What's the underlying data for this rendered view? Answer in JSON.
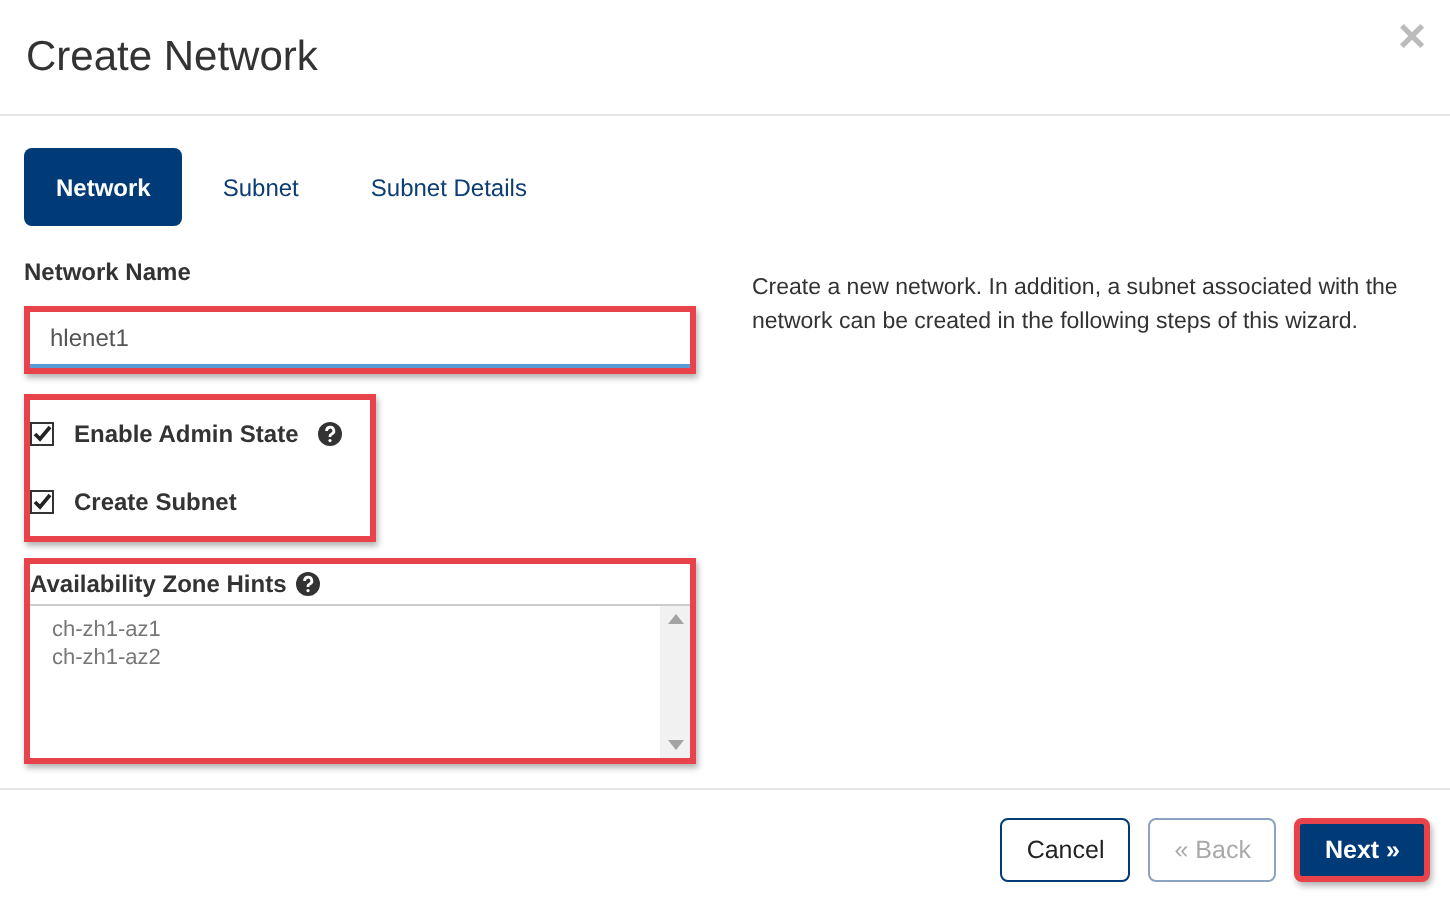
{
  "dialog": {
    "title": "Create Network",
    "close": "×"
  },
  "tabs": [
    {
      "label": "Network",
      "selected": true
    },
    {
      "label": "Subnet",
      "selected": false
    },
    {
      "label": "Subnet Details",
      "selected": false
    }
  ],
  "network_name": {
    "label": "Network Name",
    "value": "hlenet1"
  },
  "checkboxes": [
    {
      "label": "Enable Admin State",
      "checked": true,
      "help": true
    },
    {
      "label": "Create Subnet",
      "checked": true,
      "help": false
    }
  ],
  "availability_zone_hints": {
    "label": "Availability Zone Hints",
    "options": [
      "ch-zh1-az1",
      "ch-zh1-az2"
    ]
  },
  "description": "Create a new network. In addition, a subnet associated with the network can be created in the following steps of this wizard.",
  "buttons": [
    {
      "label": "Cancel",
      "kind": "cancel",
      "disabled": false
    },
    {
      "label": "« Back",
      "kind": "back",
      "disabled": true
    },
    {
      "label": "Next »",
      "kind": "primary",
      "disabled": false
    }
  ]
}
